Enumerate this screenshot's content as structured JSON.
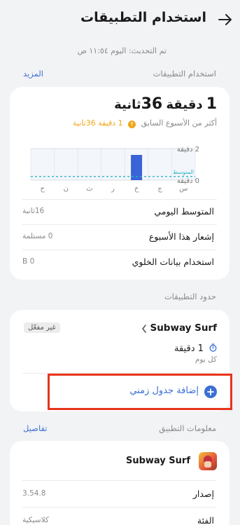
{
  "header": {
    "title": "استخدام التطبيقات",
    "back_icon": "arrow-right-icon"
  },
  "updated": "تم التحديث: اليوم ١١:٥٤ ص",
  "usage_section": {
    "title": "استخدام التطبيقات",
    "more_label": "المزيد",
    "total_minutes": "1",
    "minute_unit": "دقيقة",
    "total_seconds": "36",
    "second_unit": "ثانية",
    "compare_label": "أكثر من الأسبوع السابق",
    "compare_value": "1 دقيقة 36ثانية",
    "compare_icon": "arrow-up-circle-icon",
    "accent_color": "#f0a51a"
  },
  "chart_data": {
    "type": "bar",
    "categories": [
      "س",
      "ج",
      "خ",
      "ر",
      "ث",
      "ن",
      "ح"
    ],
    "values": [
      0,
      0,
      1.6,
      0,
      0,
      0,
      0
    ],
    "average": 0.23,
    "average_label": "المتوسط",
    "y_tick_labels": [
      "2 دقيقة",
      "0 دقيقة"
    ],
    "ylim": [
      0,
      2
    ],
    "bar_color": "#3a63d8",
    "average_color": "#2bb5c9",
    "grid": true
  },
  "stats": [
    {
      "label": "المتوسط اليومي",
      "value": "16ثانية"
    },
    {
      "label": "إشعار هذا الأسبوع",
      "value": "0 مستلمة"
    },
    {
      "label": "استخدام بيانات الخلوي",
      "value": "0 B"
    }
  ],
  "limits_section": {
    "title": "حدود التطبيقات",
    "app_name": "Subway Surf",
    "status_badge": "غير مفعّل",
    "limit_value": "1 دقيقة",
    "limit_icon": "timer-icon",
    "frequency": "كل يوم",
    "add_label": "إضافة جدول زمني",
    "add_icon": "plus-circle-icon",
    "highlight_color": "#e8341c"
  },
  "app_info_section": {
    "title": "معلومات التطبيق",
    "details_label": "تفاصيل",
    "app_name": "Subway Surf",
    "app_icon": "subway-surf-app-icon",
    "rows": [
      {
        "label": "إصدار",
        "value": "3.54.8"
      },
      {
        "label": "الفئة",
        "value": "كلاسيكية"
      }
    ]
  }
}
